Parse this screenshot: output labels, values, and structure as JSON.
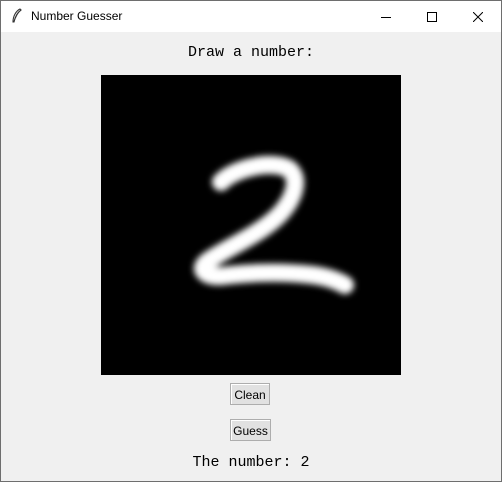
{
  "window": {
    "title": "Number Guesser",
    "app_icon": "feather-icon",
    "controls": [
      "minimize-icon",
      "maximize-icon",
      "close-icon"
    ]
  },
  "main": {
    "prompt": "Draw a number:",
    "canvas": {
      "background": "#000000",
      "stroke_color": "#ffffff",
      "drawn_digit": "2"
    },
    "clean_label": "Clean",
    "guess_label": "Guess",
    "result_text": "The number: 2"
  }
}
